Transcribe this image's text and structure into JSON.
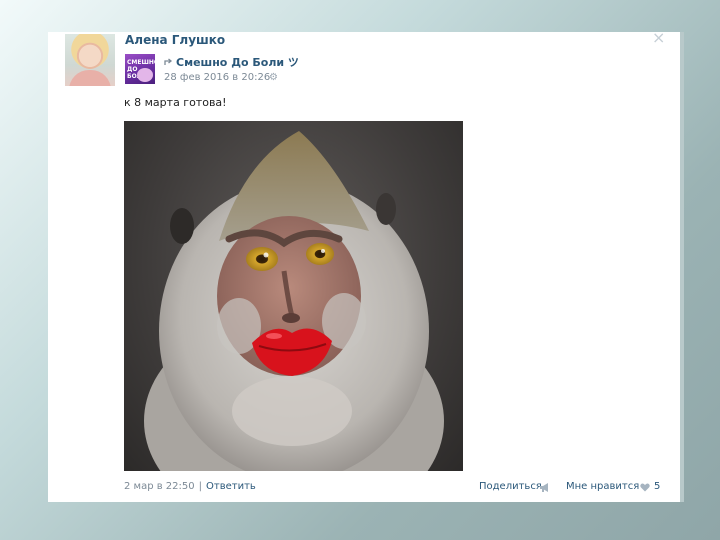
{
  "post": {
    "author_name": "Алена Глушко",
    "close_glyph": "×",
    "group_name": "Смешно До Боли ツ",
    "date": "28 фев 2016 в 20:26",
    "text": "к 8 марта готова!",
    "photo_subject": "monkey-with-red-lips",
    "group_avatar_text": "СМЕШНО ДО БОЛИ"
  },
  "footer": {
    "timestamp": "2 мар в 22:50",
    "separator": "|",
    "reply_label": "Ответить",
    "share_label": "Поделиться",
    "like_label": "Мне нравится",
    "like_count": "5"
  },
  "icons": {
    "close": "close-icon",
    "repost": "repost-arrow-icon",
    "settings": "gear-icon",
    "share": "megaphone-icon",
    "like": "heart-icon"
  },
  "colors": {
    "link": "#2b587a",
    "muted": "#7d8a96",
    "card_bg": "#ffffff",
    "page_bg": "#9bb3b4"
  }
}
